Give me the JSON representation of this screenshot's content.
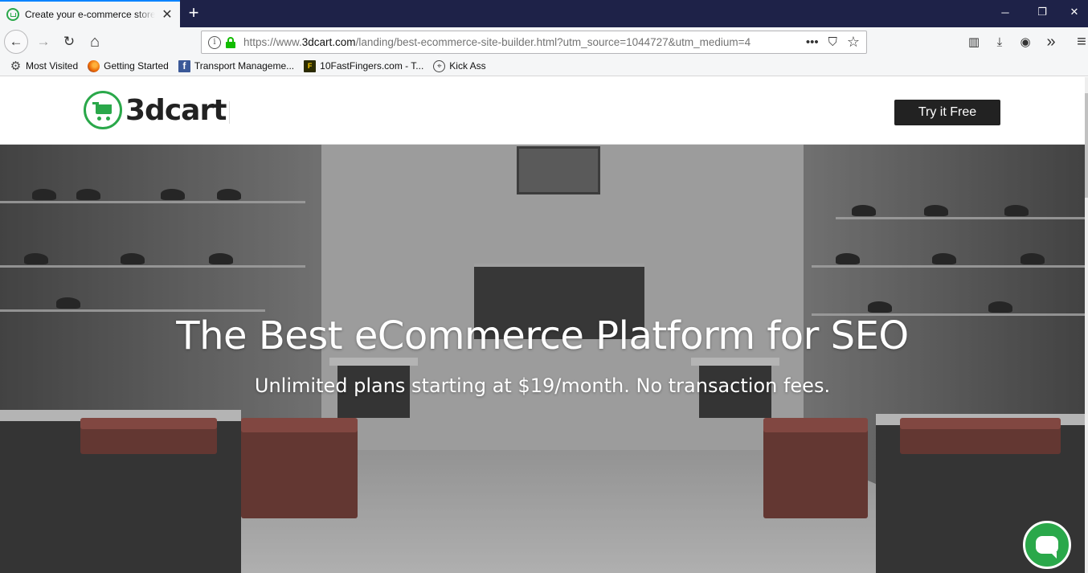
{
  "browser": {
    "tab": {
      "title": "Create your e-commerce store",
      "close_glyph": "✕"
    },
    "new_tab_glyph": "+",
    "window": {
      "minimize": "─",
      "restore": "❐",
      "close": "✕"
    },
    "nav": {
      "back": "←",
      "forward": "→",
      "reload": "↻",
      "home": "⌂"
    },
    "url": {
      "prefix": "https://www.",
      "host": "3dcart.com",
      "path": "/landing/best-ecommerce-site-builder.html?utm_source=1044727&utm_medium=4",
      "info_glyph": "i",
      "more_glyph": "•••",
      "pocket_glyph": "⛉",
      "star_glyph": "☆"
    },
    "toolbar": {
      "library": "▥",
      "download": "⤓",
      "account": "◉",
      "overflow": "»",
      "menu": "≡"
    },
    "bookmarks": [
      {
        "label": "Most Visited",
        "icon": "gear-icon",
        "glyph": "⚙"
      },
      {
        "label": "Getting Started",
        "icon": "firefox-icon",
        "glyph": ""
      },
      {
        "label": "Transport Manageme...",
        "icon": "facebook-icon",
        "glyph": "f"
      },
      {
        "label": "10FastFingers.com - T...",
        "icon": "tenfastfingers-icon",
        "glyph": "F"
      },
      {
        "label": "Kick Ass",
        "icon": "globe-icon",
        "glyph": "⌖"
      }
    ]
  },
  "site": {
    "logo_text": "3dcart",
    "cta_label": "Try it Free",
    "hero": {
      "title": "The Best eCommerce Platform for SEO",
      "subtitle": "Unlimited plans starting at $19/month. No transaction fees."
    },
    "colors": {
      "brand_green": "#2aa84a",
      "cta_bg": "#222222",
      "titlebar": "#1e2248"
    }
  }
}
